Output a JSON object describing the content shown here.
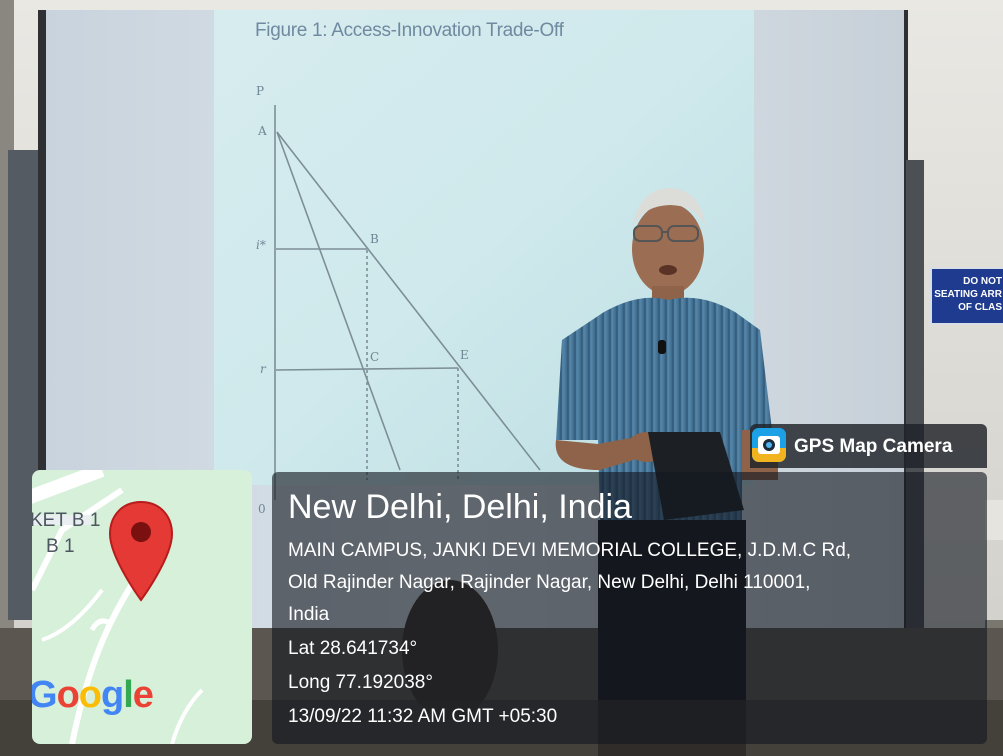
{
  "slide": {
    "title": "Figure 1: Access-Innovation Trade-Off",
    "axis_p": "P",
    "label_a": "A",
    "label_b": "B",
    "label_c": "C",
    "label_e": "E",
    "label_i_star": "i*",
    "label_r": "r",
    "label_zero": "0"
  },
  "wall_sign": {
    "line1": "DO NOT",
    "line2": "SEATING ARR",
    "line3": "OF CLAS"
  },
  "map": {
    "road_label_1": "KET B 1",
    "road_label_2": "B 1",
    "logo_text": "Google",
    "logo_colors": [
      "#4285F4",
      "#EA4335",
      "#FBBC05",
      "#4285F4",
      "#34A853",
      "#EA4335"
    ],
    "pin_color": "#e53935"
  },
  "overlay": {
    "app_name": "GPS Map Camera",
    "location_title": "New Delhi, Delhi, India",
    "address_line_1": "MAIN CAMPUS, JANKI DEVI MEMORIAL COLLEGE, J.D.M.C Rd,",
    "address_line_2": "Old Rajinder Nagar, Rajinder Nagar, New Delhi, Delhi 110001,",
    "address_line_3": "India",
    "latitude": "Lat 28.641734°",
    "longitude": "Long 77.192038°",
    "timestamp": "13/09/22 11:32 AM GMT +05:30"
  }
}
